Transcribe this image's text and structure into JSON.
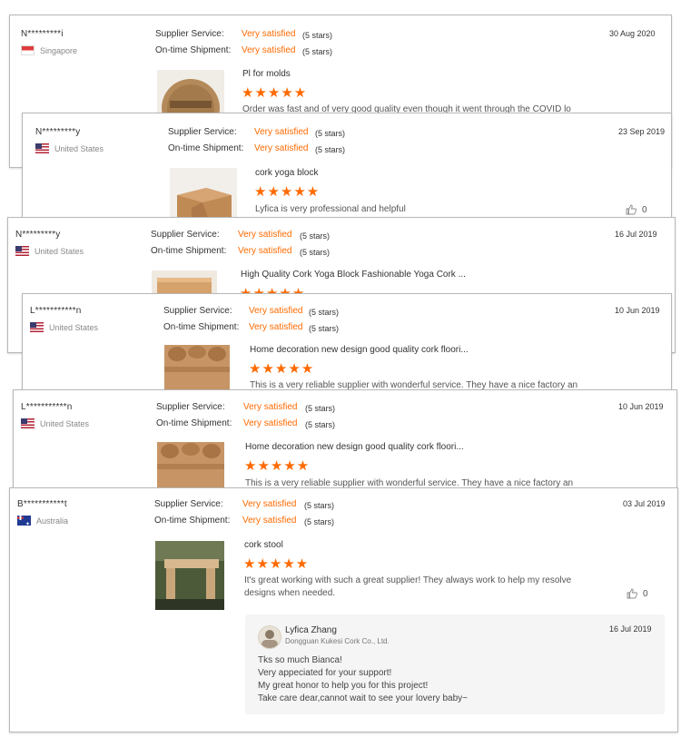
{
  "labels": {
    "supplier_service": "Supplier Service:",
    "on_time_shipment": "On-time Shipment:"
  },
  "colors": {
    "accent": "#ff6a00"
  },
  "reviews": [
    {
      "name": "N*********i",
      "country": "Singapore",
      "flag": "singapore-flag",
      "date": "30 Aug 2020",
      "supplier_service": "Very satisfied",
      "supplier_stars": "(5 stars)",
      "shipment": "Very satisfied",
      "shipment_stars": "(5 stars)",
      "product_title": "Pl for molds",
      "stars": "★★★★★",
      "rating": 5,
      "text": "Order was fast and of very good quality even though it went through the COVID lo"
    },
    {
      "name": "N*********y",
      "country": "United States",
      "flag": "us-flag",
      "date": "23 Sep 2019",
      "supplier_service": "Very satisfied",
      "supplier_stars": "(5 stars)",
      "shipment": "Very satisfied",
      "shipment_stars": "(5 stars)",
      "product_title": "cork yoga block",
      "stars": "★★★★★",
      "rating": 5,
      "text": "Lyfica is very professional and helpful",
      "likes": "0"
    },
    {
      "name": "N*********y",
      "country": "United States",
      "flag": "us-flag",
      "date": "16 Jul 2019",
      "supplier_service": "Very satisfied",
      "supplier_stars": "(5 stars)",
      "shipment": "Very satisfied",
      "shipment_stars": "(5 stars)",
      "product_title": "High Quality Cork Yoga Block Fashionable Yoga Cork ...",
      "stars": "★★★★★",
      "rating": 5
    },
    {
      "name": "L***********n",
      "country": "United States",
      "flag": "us-flag",
      "date": "10 Jun 2019",
      "supplier_service": "Very satisfied",
      "supplier_stars": "(5 stars)",
      "shipment": "Very satisfied",
      "shipment_stars": "(5 stars)",
      "product_title": "Home decoration new design good quality cork floori...",
      "stars": "★★★★★",
      "rating": 5,
      "text": "This is a very reliable supplier with wonderful service.  They have a nice factory an"
    },
    {
      "name": "L***********n",
      "country": "United States",
      "flag": "us-flag",
      "date": "10 Jun 2019",
      "supplier_service": "Very satisfied",
      "supplier_stars": "(5 stars)",
      "shipment": "Very satisfied",
      "shipment_stars": "(5 stars)",
      "product_title": "Home decoration new design good quality cork floori...",
      "stars": "★★★★★",
      "rating": 5,
      "text": "This is a very reliable supplier with wonderful service.  They have a nice factory an"
    },
    {
      "name": "B***********t",
      "country": "Australia",
      "flag": "australia-flag",
      "date": "03 Jul 2019",
      "supplier_service": "Very satisfied",
      "supplier_stars": "(5 stars)",
      "shipment": "Very satisfied",
      "shipment_stars": "(5 stars)",
      "product_title": "cork stool",
      "stars": "★★★★★",
      "rating": 5,
      "text_line1": "It's great working with such a great supplier! They always work to help my resolve",
      "text_line2": "designs when needed.",
      "likes": "0",
      "reply": {
        "author": "Lyfica Zhang",
        "company": "Dongguan Kukesi Cork Co., Ltd.",
        "date": "16 Jul 2019",
        "lines": [
          "Tks so much Bianca!",
          "Very appeciated for your support!",
          "My great honor to help you for this project!",
          "Take care dear,cannot wait to see your lovery baby~"
        ]
      }
    }
  ]
}
